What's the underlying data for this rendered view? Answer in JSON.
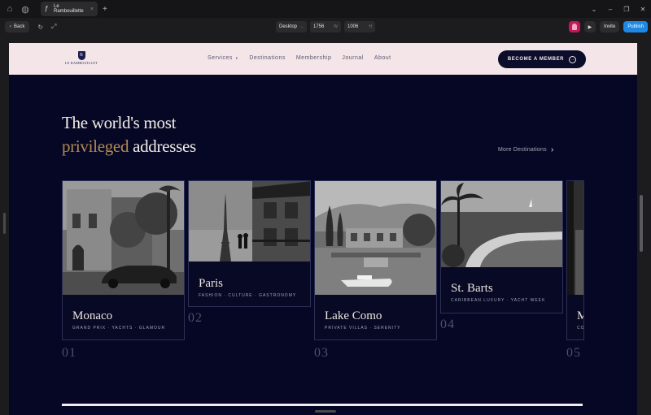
{
  "browser": {
    "tab_title": "Le Rambouillette",
    "tab_close": "×",
    "tab_add": "+"
  },
  "toolbar": {
    "back_label": "Back",
    "device": "Desktop",
    "width": "1756",
    "width_unit": "W",
    "height": "1006",
    "height_unit": "H",
    "invite_label": "Invite",
    "publish_label": "Publish"
  },
  "site": {
    "logo_text": "LE RAMBOUILLET",
    "logo_mark": "R",
    "nav": [
      {
        "label": "Services"
      },
      {
        "label": "Destinations"
      },
      {
        "label": "Membership"
      },
      {
        "label": "Journal"
      },
      {
        "label": "About"
      }
    ],
    "cta_label": "BECOME A MEMBER",
    "headline_line1": "The world's most",
    "headline_gold": "privileged",
    "headline_rest": " addresses",
    "more_label": "More Destinations",
    "cards": [
      {
        "city": "Monaco",
        "tags": "GRAND PRIX · YACHTS · GLAMOUR",
        "num": "01"
      },
      {
        "city": "Paris",
        "tags": "FASHION · CULTURE · GASTRONOMY",
        "num": "02"
      },
      {
        "city": "Lake Como",
        "tags": "PRIVATE VILLAS · SERENITY",
        "num": "03"
      },
      {
        "city": "St. Barts",
        "tags": "CARIBBEAN LUXURY · YACHT WEEK",
        "num": "04"
      },
      {
        "city": "M",
        "tags": "CO",
        "num": "05"
      }
    ]
  },
  "colors": {
    "site_bg": "#060724",
    "nav_bg": "#f3e5e8",
    "gold": "#b38a56",
    "publish": "#1e88e5"
  }
}
